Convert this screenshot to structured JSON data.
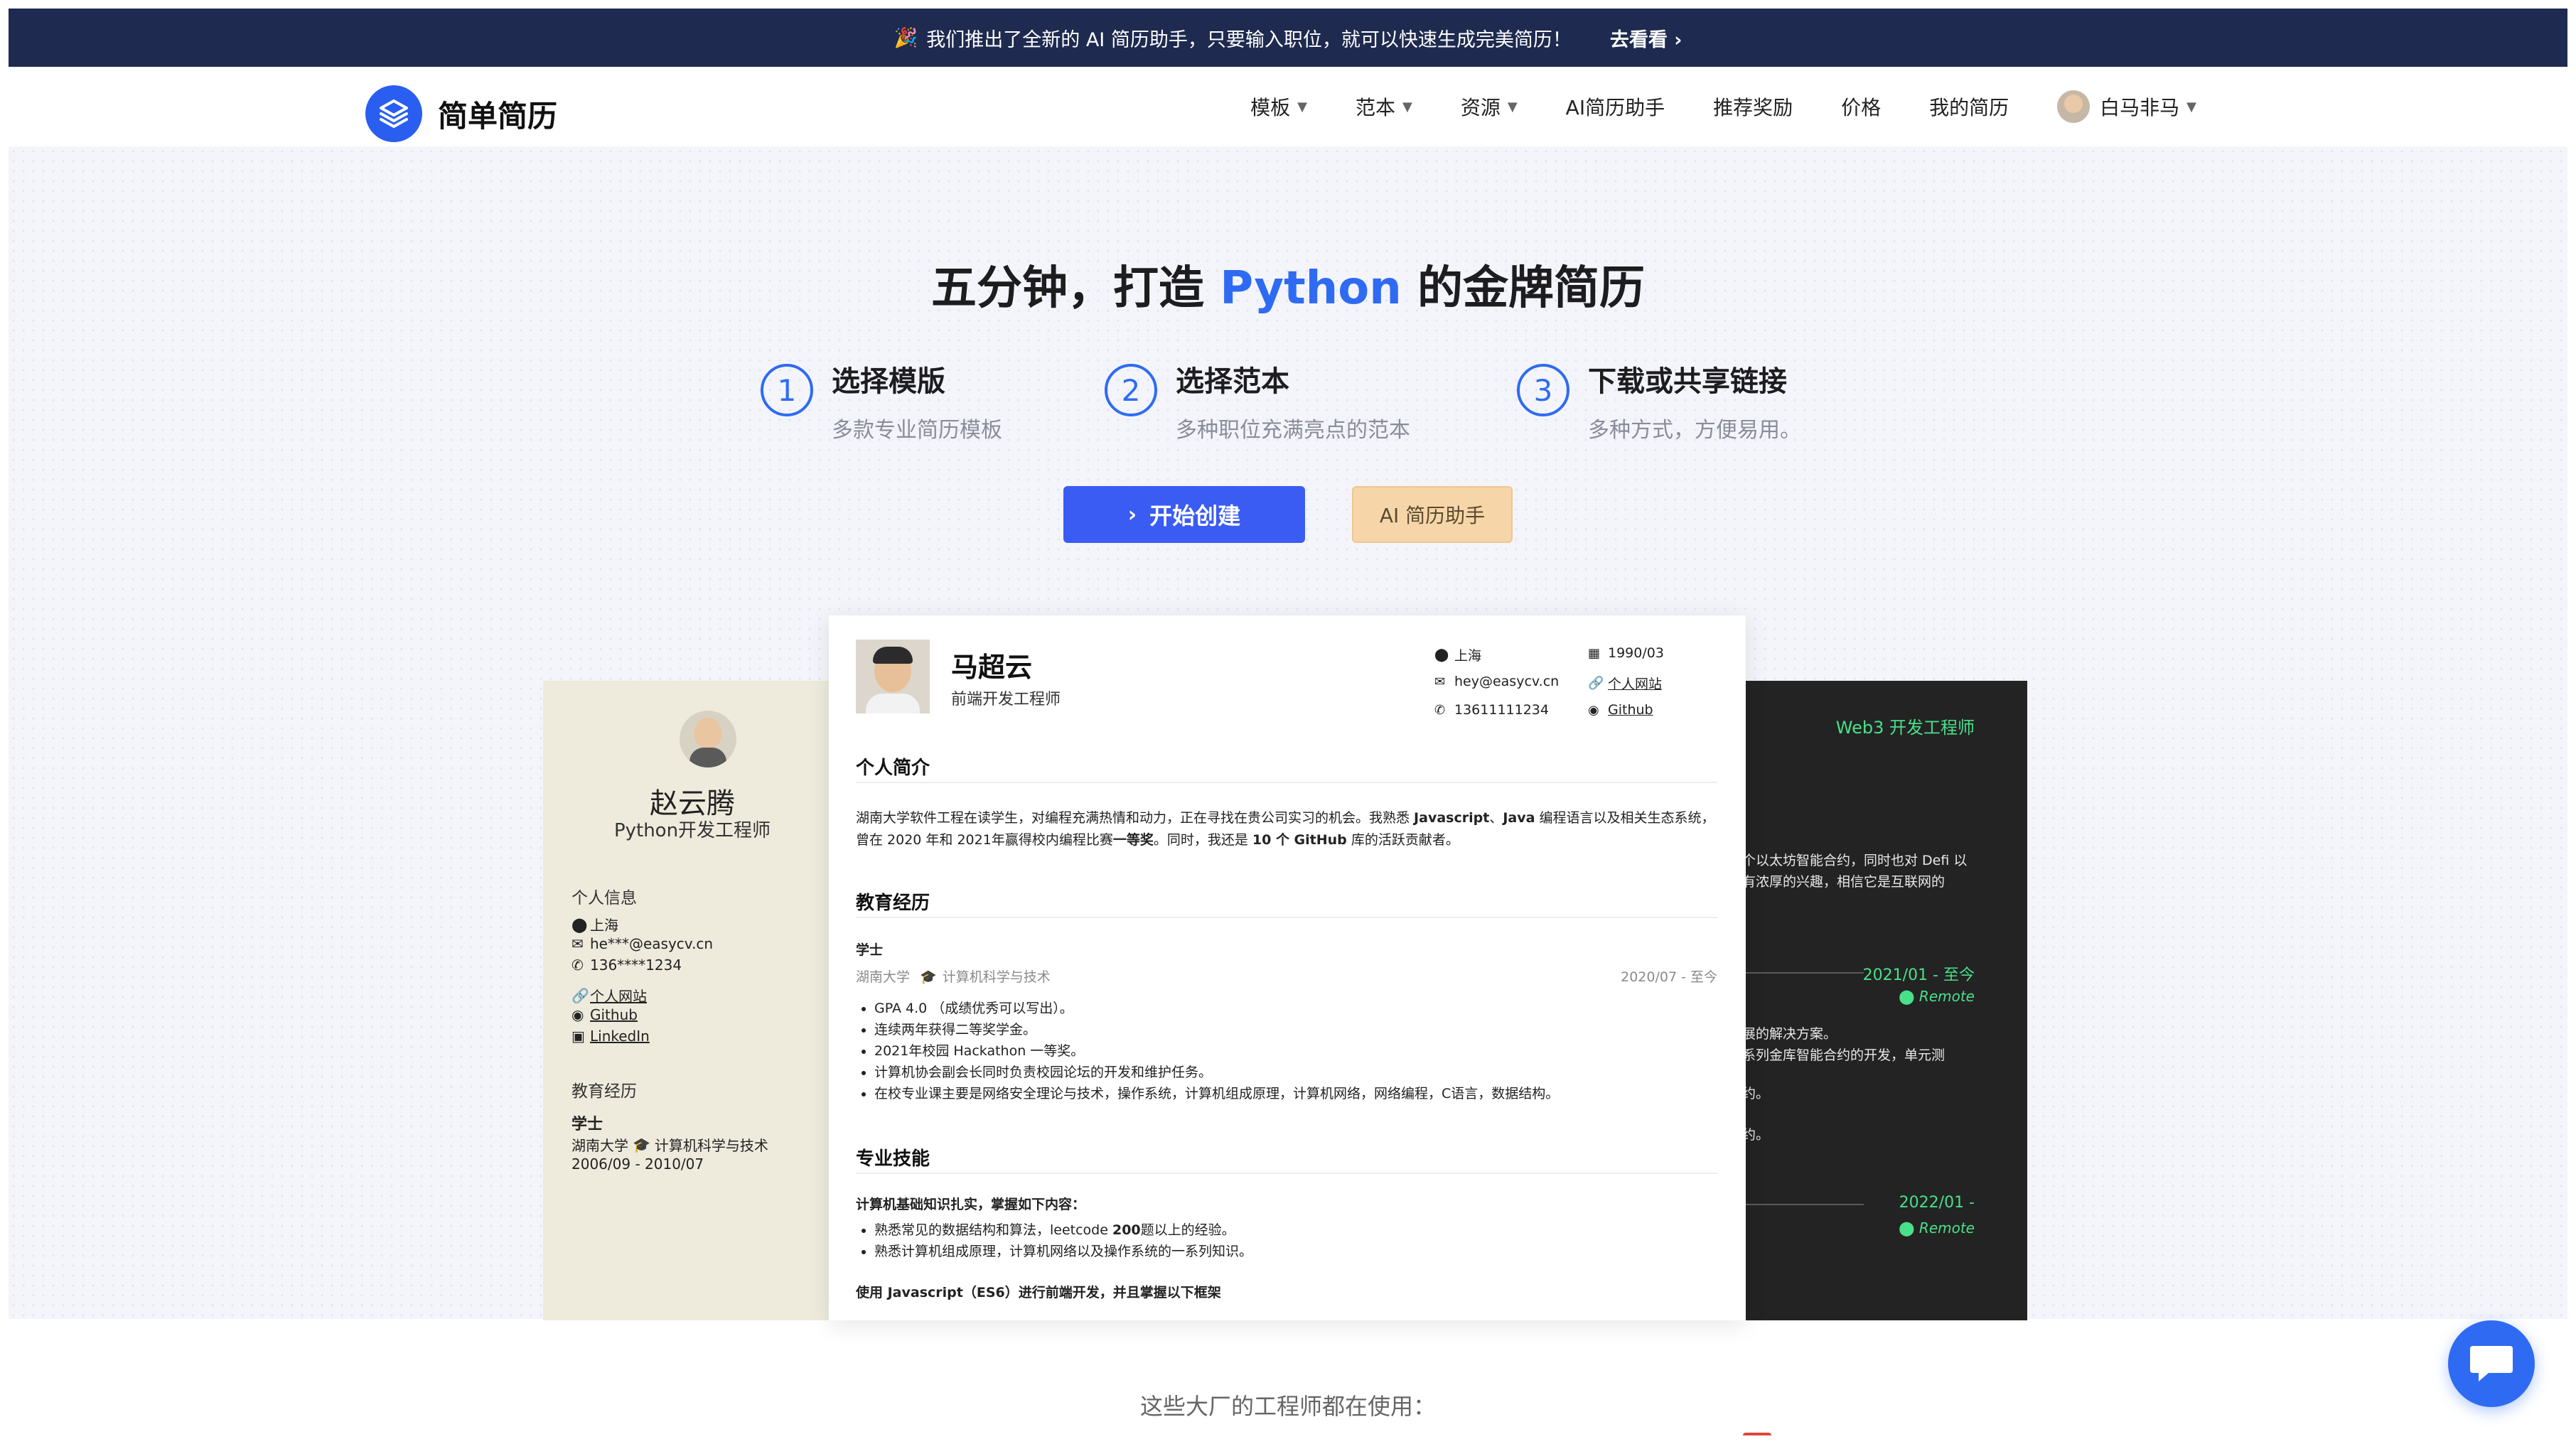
{
  "announcement": {
    "party_icon": "🎉",
    "text": "我们推出了全新的 AI 简历助手，只要输入职位，就可以快速生成完美简历！",
    "link": "去看看",
    "link_arrow": "›"
  },
  "brand": {
    "name": "简单简历",
    "color": "#2a5ef0"
  },
  "nav": {
    "items": [
      {
        "label": "模板",
        "dropdown": true
      },
      {
        "label": "范本",
        "dropdown": true
      },
      {
        "label": "资源",
        "dropdown": true
      },
      {
        "label": "AI简历助手",
        "dropdown": false
      },
      {
        "label": "推荐奖励",
        "dropdown": false
      },
      {
        "label": "价格",
        "dropdown": false
      },
      {
        "label": "我的简历",
        "dropdown": false
      }
    ],
    "user": {
      "name": "白马非马"
    }
  },
  "hero": {
    "title_prefix": "五分钟，打造 ",
    "title_highlight": "Python",
    "title_suffix": " 的金牌简历",
    "accent": "#2f6bf2",
    "steps": [
      {
        "num": "1",
        "title": "选择模版",
        "desc": "多款专业简历模板"
      },
      {
        "num": "2",
        "title": "选择范本",
        "desc": "多种职位充满亮点的范本"
      },
      {
        "num": "3",
        "title": "下载或共享链接",
        "desc": "多种方式，方便易用。"
      }
    ],
    "start_button": "开始创建",
    "ai_button": "AI 简历助手"
  },
  "resume_left": {
    "name": "赵云腾",
    "role": "Python开发工程师",
    "info_heading": "个人信息",
    "city": "上海",
    "email": "he***@easycv.cn",
    "phone": "136****1234",
    "site": "个人网站",
    "github": "Github",
    "linkedin": "LinkedIn",
    "edu_heading": "教育经历",
    "degree": "学士",
    "school": "湖南大学",
    "major": "计算机科学与技术",
    "period": "2006/09 - 2010/07"
  },
  "resume_main": {
    "name": "马超云",
    "role": "前端开发工程师",
    "city": "上海",
    "birth": "1990/03",
    "email": "hey@easycv.cn",
    "site": "个人网站",
    "phone": "13611111234",
    "github": "Github",
    "intro_heading": "个人简介",
    "intro_1": "湖南大学软件工程在读学生，对编程充满热情和动力，正在寻找在贵公司实习的机会。我熟悉 ",
    "intro_js": "Javascript",
    "intro_2": "、",
    "intro_java": "Java",
    "intro_3": " 编程语言以及相关生态系统，曾在 2020 年和 2021年赢得校内编程比赛",
    "intro_award": "一等奖",
    "intro_4": "。同时，我还是 ",
    "intro_count": "10 个 GitHub",
    "intro_5": " 库的活跃贡献者。",
    "edu_heading": "教育经历",
    "degree": "学士",
    "school": "湖南大学",
    "major": "计算机科学与技术",
    "period": "2020/07 - 至今",
    "edu_items": [
      "GPA 4.0 （成绩优秀可以写出）。",
      "连续两年获得二等奖学金。",
      "2021年校园 Hackathon 一等奖。",
      "计算机协会副会长同时负责校园论坛的开发和维护任务。",
      "在校专业课主要是网络安全理论与技术，操作系统，计算机组成原理，计算机网络，网络编程，C语言，数据结构。"
    ],
    "skills_heading": "专业技能",
    "skills_sub": "计算机基础知识扎实，掌握如下内容：",
    "skill_1a": "熟悉常见的数据结构和算法，leetcode ",
    "skill_1b": "200",
    "skill_1c": "题以上的经验。",
    "skill_2": "熟悉计算机组成原理，计算机网络以及操作系统的一系列知识。",
    "skills_sub2": "使用 Javascript（ES6）进行前端开发，并且掌握以下框架"
  },
  "resume_right": {
    "title": "Web3 开发工程师",
    "line_1": "多个以太坊智能合约，同时也对 Defi 以",
    "line_2": "域有浓厚的兴趣，相信它是互联网的",
    "date_1": "2021/01 - 至今",
    "remote_1": "Remote",
    "line_3": "扩展的解决方案。",
    "line_4": "一系列金库智能合约的开发，单元测",
    "line_5": "合约。",
    "line_6": "合约。",
    "date_2": "2022/01 -",
    "remote_2": "Remote",
    "accent": "#49e08a"
  },
  "footer": {
    "using_text": "这些大厂的工程师都在使用："
  }
}
